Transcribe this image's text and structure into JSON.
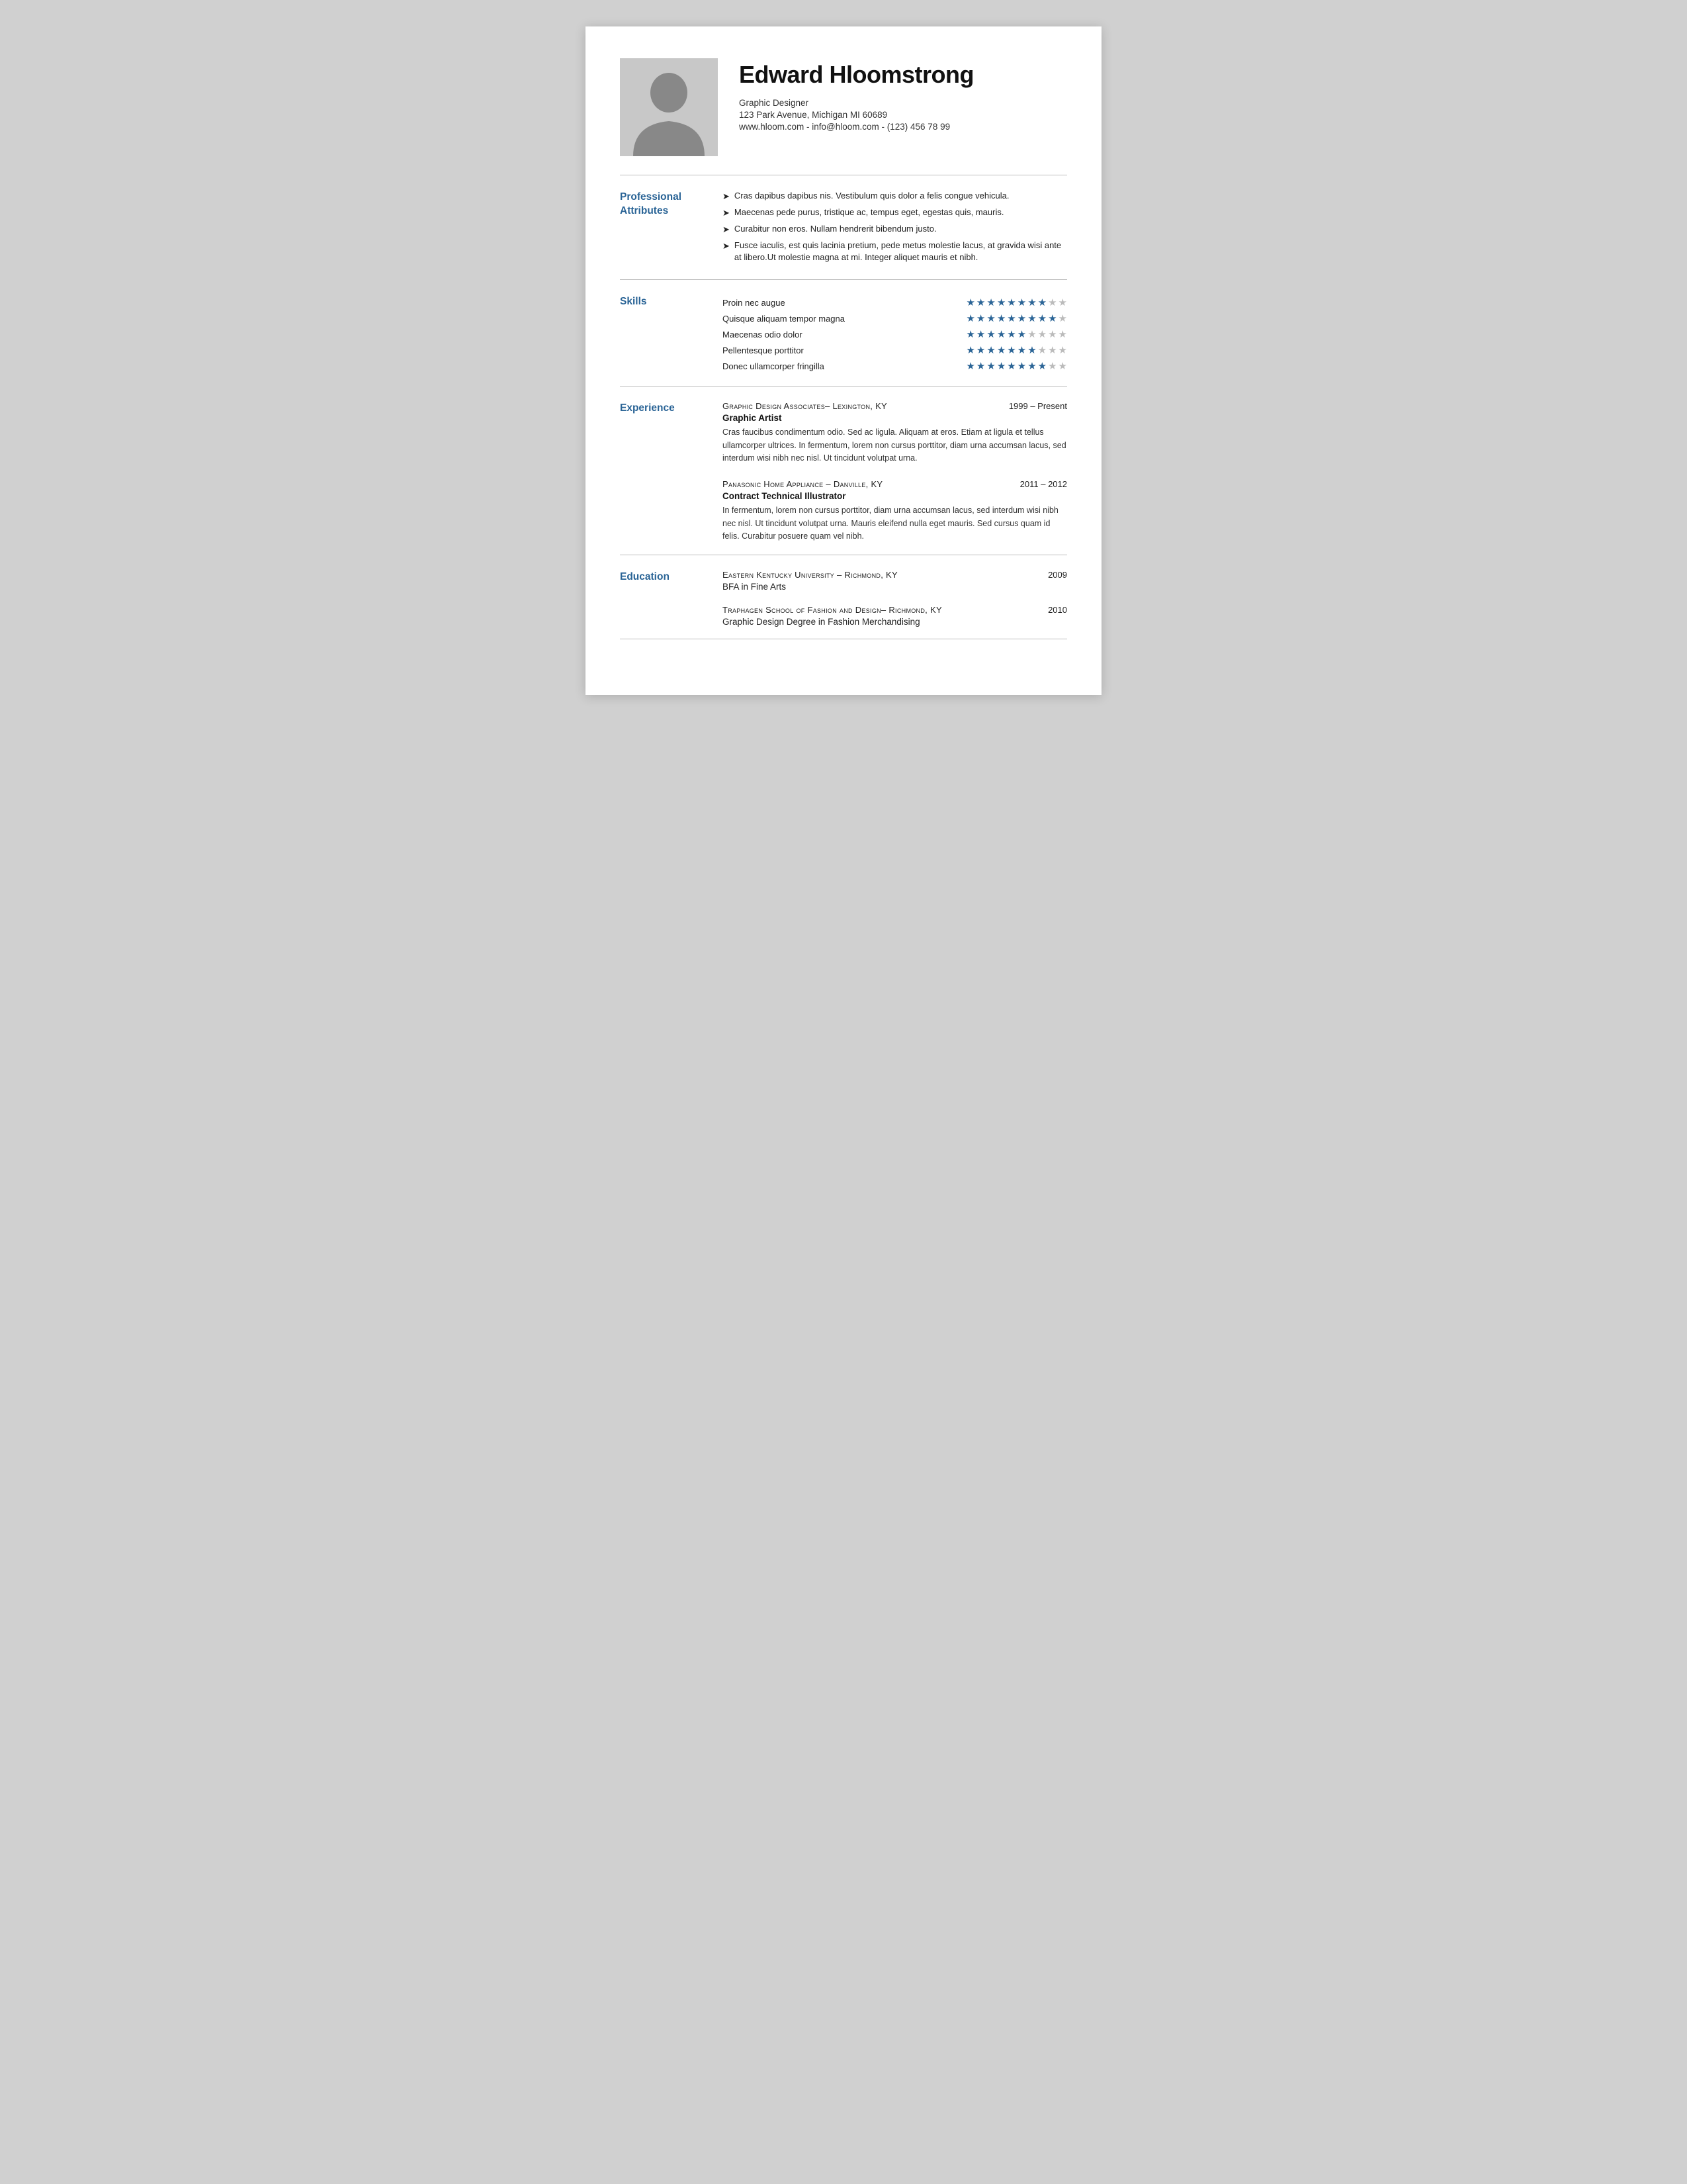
{
  "header": {
    "name": "Edward Hloomstrong",
    "title": "Graphic Designer",
    "address": "123 Park Avenue, Michigan MI 60689",
    "contact": "www.hloom.com - info@hloom.com - (123) 456 78 99"
  },
  "sections": {
    "professional_attributes": {
      "label": "Professional\nAttributes",
      "items": [
        "Cras dapibus dapibus nis. Vestibulum quis dolor a felis congue vehicula.",
        "Maecenas pede purus, tristique ac, tempus eget, egestas quis, mauris.",
        "Curabitur non eros. Nullam hendrerit bibendum justo.",
        "Fusce iaculis, est quis lacinia pretium, pede metus molestie lacus, at gravida wisi ante at libero.Ut molestie magna at mi. Integer aliquet mauris et nibh."
      ]
    },
    "skills": {
      "label": "Skills",
      "items": [
        {
          "name": "Proin nec augue",
          "filled": 8,
          "empty": 2
        },
        {
          "name": "Quisque aliquam tempor magna",
          "filled": 9,
          "empty": 1
        },
        {
          "name": "Maecenas odio dolor",
          "filled": 6,
          "empty": 4
        },
        {
          "name": "Pellentesque porttitor",
          "filled": 7,
          "empty": 3
        },
        {
          "name": "Donec ullamcorper fringilla",
          "filled": 8,
          "empty": 2
        }
      ]
    },
    "experience": {
      "label": "Experience",
      "items": [
        {
          "company": "Graphic Design Associates– Lexington, KY",
          "date": "1999 – Present",
          "role": "Graphic Artist",
          "description": "Cras faucibus condimentum odio. Sed ac ligula. Aliquam at eros. Etiam at ligula et tellus ullamcorper ultrices. In fermentum, lorem non cursus porttitor, diam urna accumsan lacus, sed interdum wisi nibh nec nisl. Ut tincidunt volutpat urna."
        },
        {
          "company": "Panasonic Home Appliance – Danville, KY",
          "date": "2011 – 2012",
          "role": "Contract Technical Illustrator",
          "description": "In fermentum, lorem non cursus porttitor, diam urna accumsan lacus, sed interdum wisi nibh nec nisl. Ut tincidunt volutpat urna. Mauris eleifend nulla eget mauris. Sed cursus quam id felis. Curabitur posuere quam vel nibh."
        }
      ]
    },
    "education": {
      "label": "Education",
      "items": [
        {
          "school": "Eastern Kentucky University – Richmond, KY",
          "date": "2009",
          "degree": "BFA in Fine Arts"
        },
        {
          "school": "Traphagen School of Fashion and Design– Richmond, KY",
          "date": "2010",
          "degree": "Graphic Design Degree in Fashion Merchandising"
        }
      ]
    }
  }
}
